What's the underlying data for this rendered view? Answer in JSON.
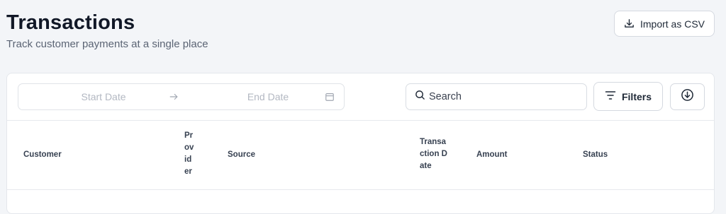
{
  "header": {
    "title": "Transactions",
    "subtitle": "Track customer payments at a single place",
    "import_label": "Import as CSV"
  },
  "toolbar": {
    "start_date_placeholder": "Start Date",
    "end_date_placeholder": "End Date",
    "search_placeholder": "Search",
    "filters_label": "Filters"
  },
  "table": {
    "columns": [
      "Customer",
      "Provider",
      "Source",
      "Transaction Date",
      "Amount",
      "Status"
    ]
  },
  "icons": {
    "import": "download-tray-icon",
    "date_arrow": "arrow-right-icon",
    "calendar": "calendar-icon",
    "search": "search-icon",
    "filters": "filter-lines-icon",
    "download": "circle-arrow-down-icon"
  }
}
